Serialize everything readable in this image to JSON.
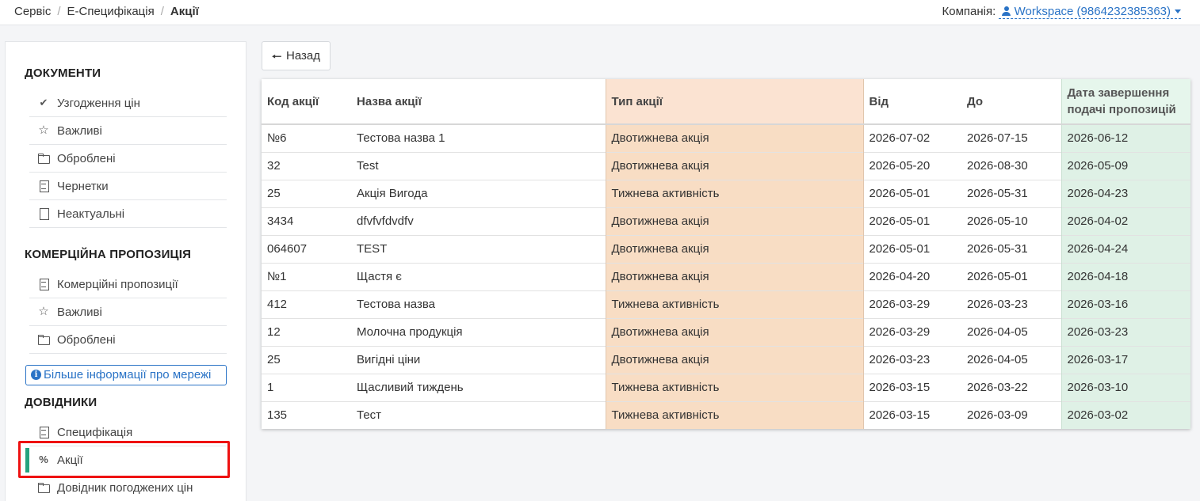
{
  "breadcrumb": {
    "items": [
      "Сервіс",
      "Е-Специфікація"
    ],
    "current": "Акції",
    "separator": "/"
  },
  "company": {
    "label": "Компанія:",
    "value": "Workspace (9864232385363)"
  },
  "sidebar": {
    "documents_title": "ДОКУМЕНТИ",
    "documents": [
      {
        "label": "Узгодження цін",
        "icon": "check-icon"
      },
      {
        "label": "Важливі",
        "icon": "star-icon"
      },
      {
        "label": "Оброблені",
        "icon": "folder-icon"
      },
      {
        "label": "Чернетки",
        "icon": "document-icon"
      },
      {
        "label": "Неактуальні",
        "icon": "file-icon"
      }
    ],
    "commercial_title": "КОМЕРЦІЙНА ПРОПОЗИЦІЯ",
    "commercial": [
      {
        "label": "Комерційні пропозиції",
        "icon": "document-icon"
      },
      {
        "label": "Важливі",
        "icon": "star-icon"
      },
      {
        "label": "Оброблені",
        "icon": "folder-icon"
      }
    ],
    "info_button": "Більше інформації про мережі",
    "reference_title": "ДОВІДНИКИ",
    "reference": [
      {
        "label": "Специфікація",
        "icon": "document-icon"
      },
      {
        "label": "Акції",
        "icon": "percent-icon",
        "active": true
      },
      {
        "label": "Довідник погоджених цін",
        "icon": "folder-open-icon"
      }
    ]
  },
  "back_button": "Назад",
  "table": {
    "headers": {
      "code": "Код акції",
      "name": "Назва акції",
      "type": "Тип акції",
      "from": "Від",
      "to": "До",
      "deadline": "Дата завершення подачі пропозицій"
    },
    "rows": [
      {
        "code": "№6",
        "name": "Тестова назва 1",
        "type": "Двотижнева акція",
        "from": "2026-07-02",
        "to": "2026-07-15",
        "deadline": "2026-06-12"
      },
      {
        "code": "32",
        "name": "Test",
        "type": "Двотижнева акція",
        "from": "2026-05-20",
        "to": "2026-08-30",
        "deadline": "2026-05-09"
      },
      {
        "code": "25",
        "name": "Акція Вигода",
        "type": "Тижнева активність",
        "from": "2026-05-01",
        "to": "2026-05-31",
        "deadline": "2026-04-23"
      },
      {
        "code": "3434",
        "name": "dfvfvfdvdfv",
        "type": "Двотижнева акція",
        "from": "2026-05-01",
        "to": "2026-05-10",
        "deadline": "2026-04-02"
      },
      {
        "code": "064607",
        "name": "TEST",
        "type": "Двотижнева акція",
        "from": "2026-05-01",
        "to": "2026-05-31",
        "deadline": "2026-04-24"
      },
      {
        "code": "№1",
        "name": "Щастя є",
        "type": "Двотижнева акція",
        "from": "2026-04-20",
        "to": "2026-05-01",
        "deadline": "2026-04-18"
      },
      {
        "code": "412",
        "name": "Тестова назва",
        "type": "Тижнева активність",
        "from": "2026-03-29",
        "to": "2026-03-23",
        "deadline": "2026-03-16"
      },
      {
        "code": "12",
        "name": "Молочна продукція",
        "type": "Двотижнева акція",
        "from": "2026-03-29",
        "to": "2026-04-05",
        "deadline": "2026-03-23"
      },
      {
        "code": "25",
        "name": "Вигідні ціни",
        "type": "Двотижнева акція",
        "from": "2026-03-23",
        "to": "2026-04-05",
        "deadline": "2026-03-17"
      },
      {
        "code": "1",
        "name": "Щасливий тиждень",
        "type": "Тижнева активність",
        "from": "2026-03-15",
        "to": "2026-03-22",
        "deadline": "2026-03-10"
      },
      {
        "code": "135",
        "name": "Тест",
        "type": "Тижнева активність",
        "from": "2026-03-15",
        "to": "2026-03-09",
        "deadline": "2026-03-02"
      }
    ]
  },
  "colors": {
    "accent": "#25a27e",
    "link": "#2a73c6",
    "type_column": "#f8ddc4",
    "deadline_column": "#dff1e6",
    "highlight": "#ee1111"
  }
}
